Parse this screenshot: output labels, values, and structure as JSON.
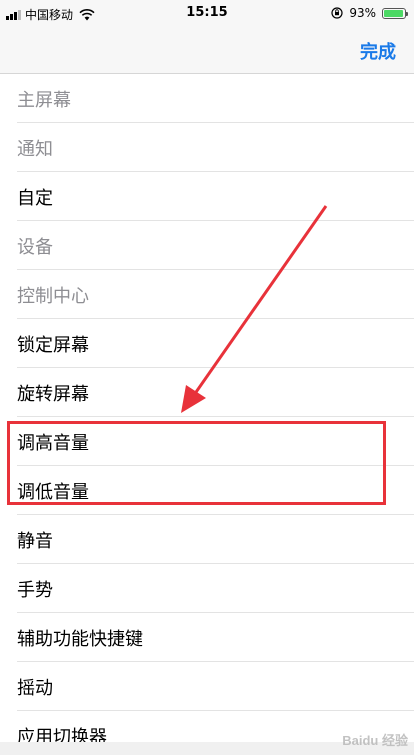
{
  "status_bar": {
    "carrier": "中国移动",
    "time": "15:15",
    "battery_percent": "93%",
    "battery_level": 0.93,
    "icons": [
      "signal-icon",
      "wifi-icon",
      "rotation-lock-icon",
      "battery-icon"
    ]
  },
  "nav": {
    "done_label": "完成"
  },
  "list": {
    "items": [
      {
        "label": "主屏幕",
        "kind": "header"
      },
      {
        "label": "通知",
        "kind": "header"
      },
      {
        "label": "自定",
        "kind": "item"
      },
      {
        "label": "设备",
        "kind": "header"
      },
      {
        "label": "控制中心",
        "kind": "header"
      },
      {
        "label": "锁定屏幕",
        "kind": "item"
      },
      {
        "label": "旋转屏幕",
        "kind": "item"
      },
      {
        "label": "调高音量",
        "kind": "item"
      },
      {
        "label": "调低音量",
        "kind": "item"
      },
      {
        "label": "静音",
        "kind": "item"
      },
      {
        "label": "手势",
        "kind": "item"
      },
      {
        "label": "辅助功能快捷键",
        "kind": "item"
      },
      {
        "label": "摇动",
        "kind": "item"
      },
      {
        "label": "应用切换器",
        "kind": "item"
      }
    ]
  },
  "annotation": {
    "color": "#e8323a"
  },
  "watermark": {
    "text": "Baidu 经验"
  },
  "colors": {
    "accent": "#1a7ae8",
    "battery": "#4cd964",
    "header_text": "#8e8e93"
  }
}
